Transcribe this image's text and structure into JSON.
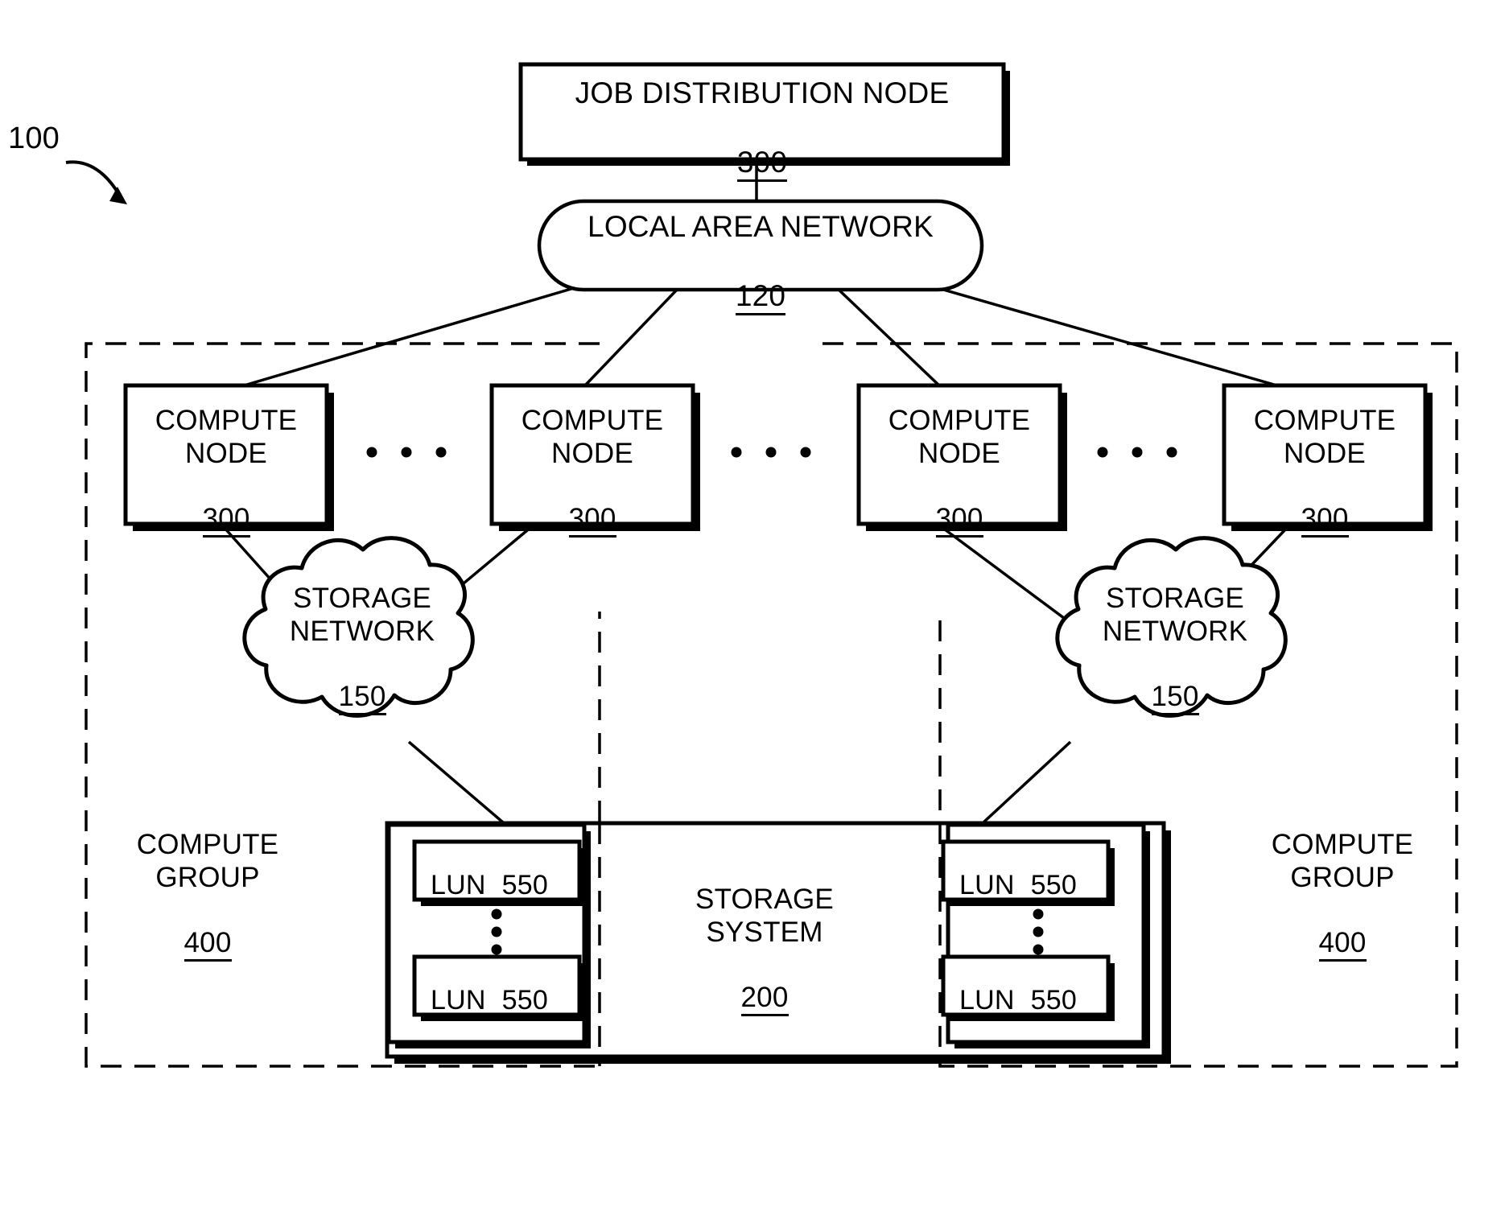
{
  "figure": {
    "number": "100",
    "type": "patent-block-diagram",
    "background": "#ffffff",
    "stroke": "#000000"
  },
  "job_distribution_node": {
    "title": "JOB DISTRIBUTION NODE",
    "ref": "300"
  },
  "local_area_network": {
    "title": "LOCAL AREA NETWORK",
    "ref": "120"
  },
  "compute_nodes": [
    {
      "title": "COMPUTE\nNODE",
      "ref": "300"
    },
    {
      "title": "COMPUTE\nNODE",
      "ref": "300"
    },
    {
      "title": "COMPUTE\nNODE",
      "ref": "300"
    },
    {
      "title": "COMPUTE\nNODE",
      "ref": "300"
    }
  ],
  "storage_networks": [
    {
      "title": "STORAGE\nNETWORK",
      "ref": "150"
    },
    {
      "title": "STORAGE\nNETWORK",
      "ref": "150"
    }
  ],
  "compute_groups": [
    {
      "title": "COMPUTE\nGROUP",
      "ref": "400"
    },
    {
      "title": "COMPUTE\nGROUP",
      "ref": "400"
    }
  ],
  "storage_system": {
    "title": "STORAGE\nSYSTEM",
    "ref": "200"
  },
  "luns": [
    {
      "label": "LUN",
      "ref": "550",
      "group": "left",
      "position": "top"
    },
    {
      "label": "LUN",
      "ref": "550",
      "group": "left",
      "position": "bottom"
    },
    {
      "label": "LUN",
      "ref": "550",
      "group": "right",
      "position": "top"
    },
    {
      "label": "LUN",
      "ref": "550",
      "group": "right",
      "position": "bottom"
    }
  ],
  "ellipses": {
    "horizontal_count": 3,
    "vertical_count": 3,
    "glyph": "•"
  }
}
